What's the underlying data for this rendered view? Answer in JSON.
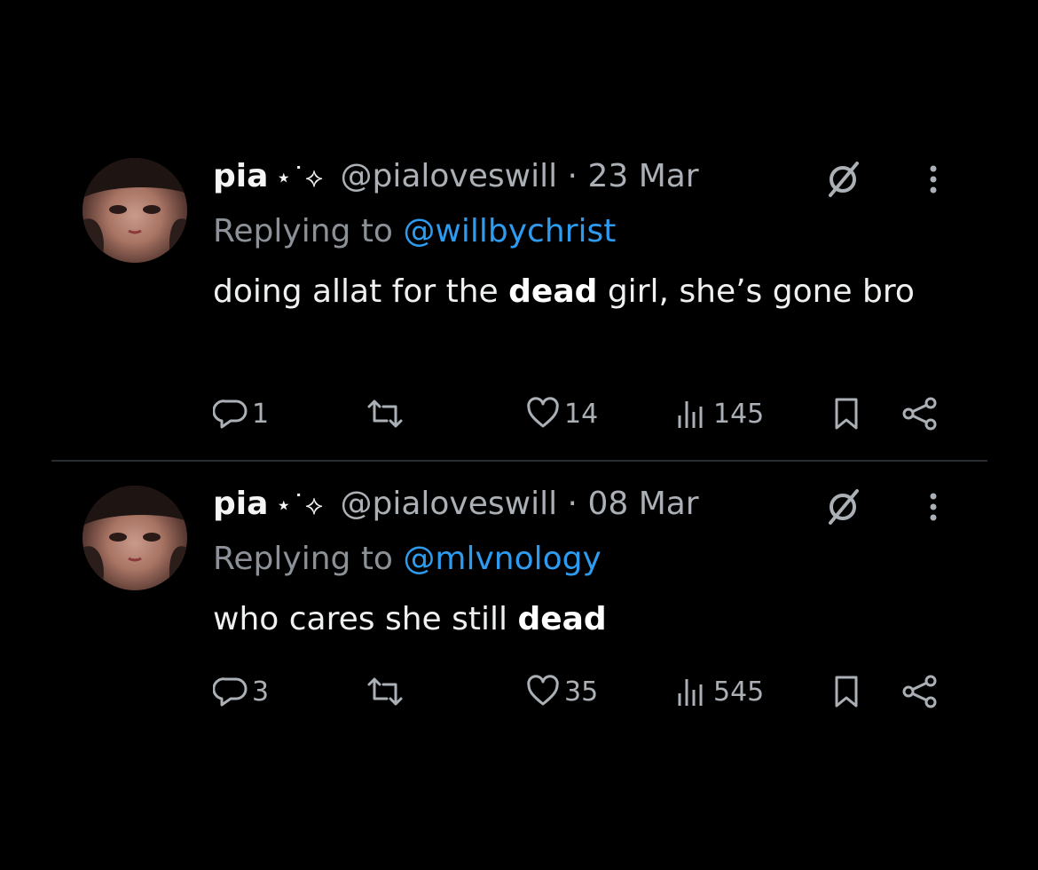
{
  "tweets": [
    {
      "name": "pia",
      "deco": "⋆˙⟡",
      "handle": "@pialoveswill",
      "separator": "·",
      "date": "23 Mar",
      "replying_prefix": "Replying to",
      "replying_to": "@willbychrist",
      "text_before": "doing allat for the ",
      "text_bold": "dead",
      "text_after": " girl, she’s gone bro",
      "replies": "1",
      "retweets": "",
      "likes": "14",
      "views": "145"
    },
    {
      "name": "pia",
      "deco": "⋆˙⟡",
      "handle": "@pialoveswill",
      "separator": "·",
      "date": "08 Mar",
      "replying_prefix": "Replying to",
      "replying_to": "@mlvnology",
      "text_before": "who cares she still ",
      "text_bold": "dead",
      "text_after": "",
      "replies": "3",
      "retweets": "",
      "likes": "35",
      "views": "545"
    }
  ],
  "icons": {
    "reply": "reply-icon",
    "retweet": "retweet-icon",
    "like": "heart-icon",
    "views": "views-icon",
    "bookmark": "bookmark-icon",
    "share": "share-icon",
    "grok": "grok-icon",
    "more": "more-icon"
  },
  "colors": {
    "background": "#000000",
    "mention": "#2d9cf0",
    "muted": "#aab0b5"
  }
}
